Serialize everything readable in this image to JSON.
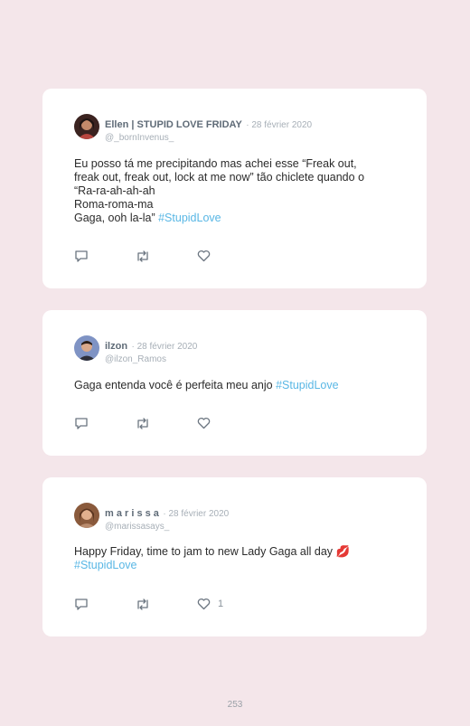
{
  "tweets": [
    {
      "name": "Ellen | STUPID LOVE FRIDAY",
      "date": "28 février 2020",
      "handle": "@_bornInvenus_",
      "text": "Eu posso tá me precipitando mas achei esse “Freak out,\nfreak out, freak out, lock at me now” tão chiclete quando o\n“Ra-ra-ah-ah-ah\nRoma-roma-ma\nGaga, ooh la-la” ",
      "hashtag": "#StupidLove",
      "likes": "",
      "avatar_color": "#3b2320"
    },
    {
      "name": "ilzon",
      "date": "28 février 2020",
      "handle": "@ilzon_Ramos",
      "text": "Gaga entenda você é perfeita meu anjo ",
      "hashtag": "#StupidLove",
      "likes": "",
      "avatar_color": "#5a6f9c"
    },
    {
      "name": "m a r i s s a",
      "date": "28 février 2020",
      "handle": "@marissasays_",
      "text": "Happy Friday, time to jam to new Lady Gaga all day 💋\n",
      "hashtag": "#StupidLove",
      "likes": "1",
      "avatar_color": "#8a5a3c"
    }
  ],
  "page_number": "253",
  "icons": {
    "reply": "reply-icon",
    "retweet": "retweet-icon",
    "like": "heart-icon"
  },
  "colors": {
    "background": "#f4e6ea",
    "hashtag": "#59b7e5",
    "name": "#5f6b77"
  }
}
